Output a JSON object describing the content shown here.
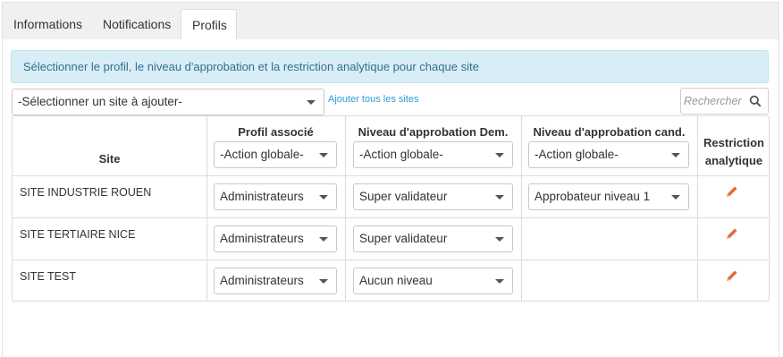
{
  "tabs": [
    {
      "label": "Informations"
    },
    {
      "label": "Notifications"
    },
    {
      "label": "Profils"
    }
  ],
  "banner": "Sélectionner le profil, le niveau d'approbation et la restriction analytique pour chaque site",
  "site_select": {
    "value": "-Sélectionner un site à ajouter-"
  },
  "add_all_link": "Ajouter tous les sites",
  "search": {
    "placeholder": "Rechercher",
    "icon": "search-icon"
  },
  "table": {
    "headers": {
      "site": "Site",
      "profil": "Profil associé",
      "niveau_dem": "Niveau d'approbation Dem.",
      "niveau_cand": "Niveau d'approbation cand.",
      "restriction_line1": "Restriction",
      "restriction_line2": "analytique"
    },
    "global_action": "-Action globale-",
    "rows": [
      {
        "site": "SITE INDUSTRIE ROUEN",
        "profil": "Administrateurs",
        "niveau_dem": "Super validateur",
        "niveau_cand": "Approbateur niveau 1"
      },
      {
        "site": "SITE TERTIAIRE NICE",
        "profil": "Administrateurs",
        "niveau_dem": "Super validateur",
        "niveau_cand": ""
      },
      {
        "site": "SITE TEST",
        "profil": "Administrateurs",
        "niveau_dem": "Aucun niveau",
        "niveau_cand": ""
      }
    ],
    "edit_icon": "pencil-icon",
    "edit_color": "#e8683a"
  }
}
